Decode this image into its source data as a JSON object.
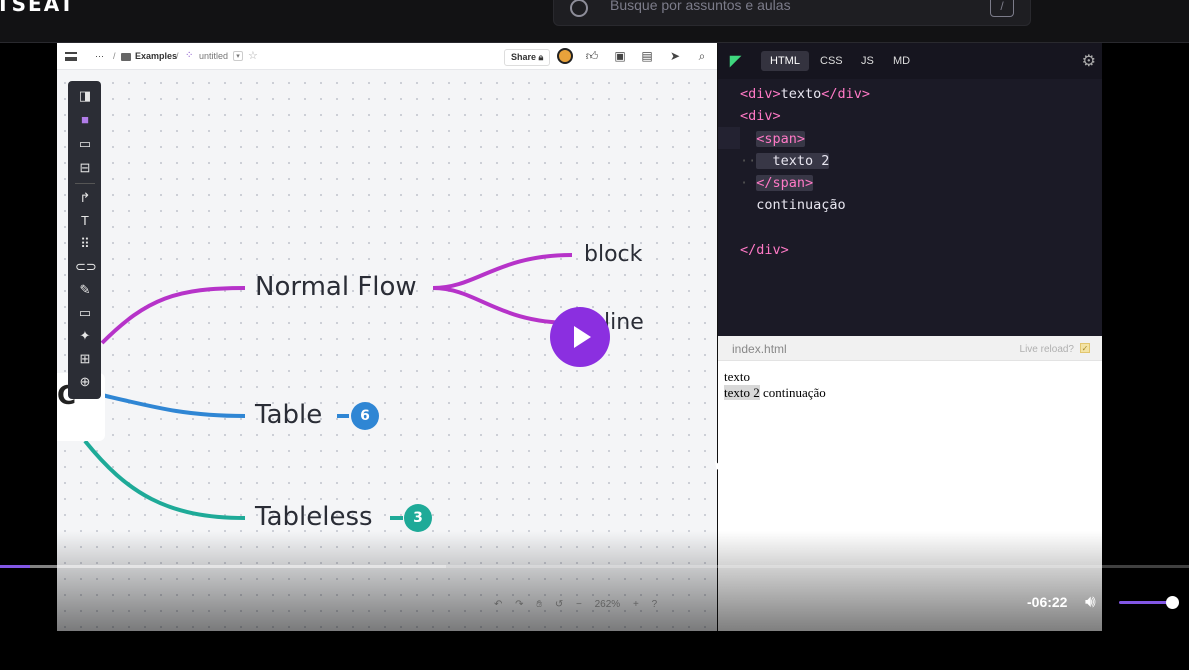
{
  "site": {
    "logo": "TSEAT",
    "search_placeholder": "Busque por assuntos e aulas",
    "search_shortcut": "/"
  },
  "whimsical": {
    "breadcrumb_more": "···",
    "breadcrumb_folder": "Examples",
    "breadcrumb_sep": "/",
    "doc_name": "untitled",
    "share_label": "Share",
    "zoom": "262%",
    "help": "?"
  },
  "mindmap": {
    "root": "C",
    "nodes": [
      {
        "label": "Normal Flow",
        "color": "#b633c9"
      },
      {
        "label": "Table",
        "color": "#2f86d4",
        "badge": "6"
      },
      {
        "label": "Tableless",
        "color": "#1eaa98",
        "badge": "3"
      }
    ],
    "children": [
      {
        "label": "block"
      },
      {
        "label": "inline"
      }
    ]
  },
  "editor": {
    "tabs": [
      "HTML",
      "CSS",
      "JS",
      "MD"
    ],
    "active_tab": "HTML",
    "code_lines": [
      "<div>texto</div>",
      "<div>",
      "  <span>",
      "    texto 2",
      "  </span>",
      "  continuação",
      "",
      "</div>"
    ]
  },
  "preview": {
    "file": "index.html",
    "live_reload_label": "Live reload?",
    "output_line1": "texto",
    "output_sel": "texto 2",
    "output_rest": " continuação"
  },
  "player": {
    "time_remaining": "-06:22",
    "played_fraction": 0.025,
    "buffered_fraction": 0.375,
    "volume": 1.0,
    "accent": "#8257e5"
  }
}
